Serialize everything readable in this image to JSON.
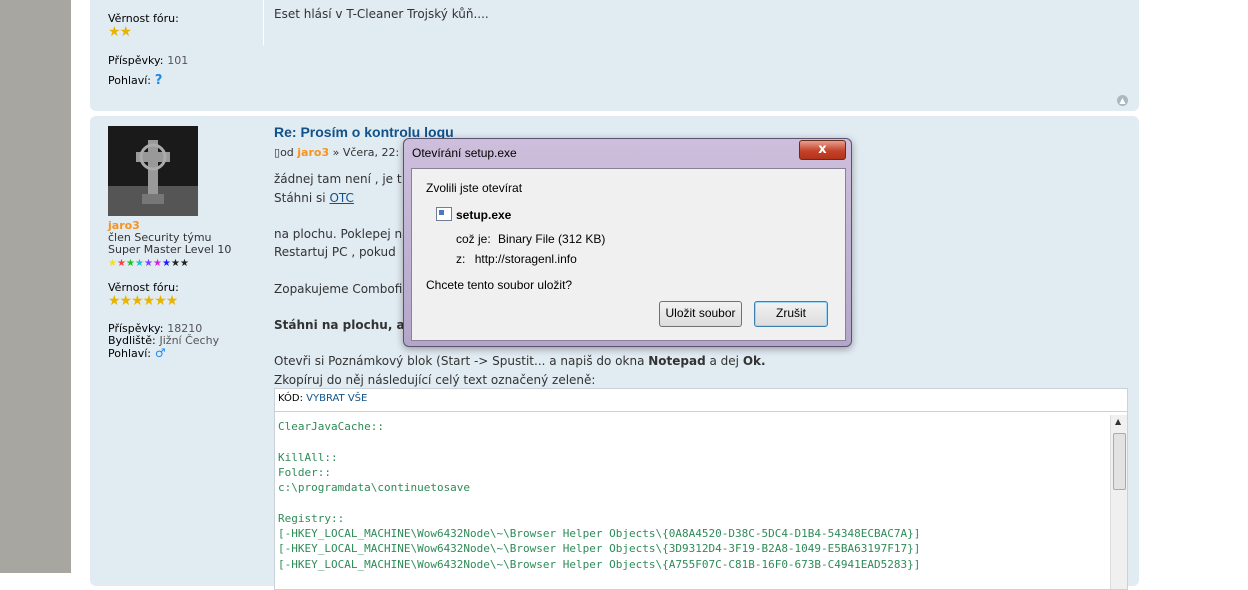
{
  "prev_post": {
    "loyalty_label": "Věrnost fóru:",
    "loyalty_stars": "★★",
    "posts_label": "Příspěvky:",
    "posts_value": "101",
    "gender_label": "Pohlaví:",
    "gender_value": "?",
    "content": "Eset hlásí v T-Cleaner Trojský kůň...."
  },
  "post": {
    "title": "Re: Prosím o kontrolu logu",
    "meta_prefix": "od",
    "author": "jaro3",
    "meta_suffix": "» Včera, 22:",
    "username": "jaro3",
    "rank1": "člen Security týmu",
    "rank2": "Super Master Level 10",
    "rank_dots": [
      "★",
      "★",
      "★",
      "★",
      "★",
      "★",
      "★",
      "★",
      "★"
    ],
    "rank_colors": [
      "#f0e020",
      "#ff4040",
      "#20c020",
      "#20c0c0",
      "#8040ff",
      "#e020e0",
      "#2020ff",
      "#202020",
      "#202020"
    ],
    "loyalty_label": "Věrnost fóru:",
    "loyalty_stars": "★★★★★★",
    "posts_label": "Příspěvky:",
    "posts_value": "18210",
    "location_label": "Bydliště:",
    "location_value": "Jižní Čechy",
    "gender_label": "Pohlaví:",
    "gender_value": "♂",
    "lines": {
      "l1": "žádnej tam není , je t",
      "l2_prefix": "Stáhni si ",
      "l2_link": "OTC",
      "l3": "na plochu. Poklepej na",
      "l4": "Restartuj PC , pokud",
      "l5": "Zopakujeme Combofix",
      "l6": "Stáhni na plochu, ale",
      "l7_a": "Otevři si Poznámkový blok (Start -> Spustit... a napiš do okna ",
      "l7_b": "Notepad",
      "l7_c": " a dej ",
      "l7_d": "Ok.",
      "l8": "Zkopíruj do něj následující celý text označený zeleně:"
    },
    "code": {
      "label": "KÓD:",
      "select_all": "VYBRAT VŠE",
      "lines": [
        "ClearJavaCache::",
        "",
        "KillAll::",
        "Folder::",
        "c:\\programdata\\continuetosave",
        "",
        "Registry::",
        "[-HKEY_LOCAL_MACHINE\\Wow6432Node\\~\\Browser Helper Objects\\{0A8A4520-D38C-5DC4-D1B4-54348ECBAC7A}]",
        "[-HKEY_LOCAL_MACHINE\\Wow6432Node\\~\\Browser Helper Objects\\{3D9312D4-3F19-B2A8-1049-E5BA63197F17}]",
        "[-HKEY_LOCAL_MACHINE\\Wow6432Node\\~\\Browser Helper Objects\\{A755F07C-C81B-16F0-673B-C4941EAD5283}]"
      ]
    }
  },
  "dialog": {
    "title": "Otevírání setup.exe",
    "close": "x",
    "intro": "Zvolili jste otevírat",
    "filename": "setup.exe",
    "type_label": "což je:",
    "type_value": "Binary File (312 KB)",
    "from_label": "z:",
    "from_value": "http://storagenl.info",
    "question": "Chcete tento soubor uložit?",
    "save_button": "Uložit soubor",
    "cancel_button": "Zrušit"
  }
}
